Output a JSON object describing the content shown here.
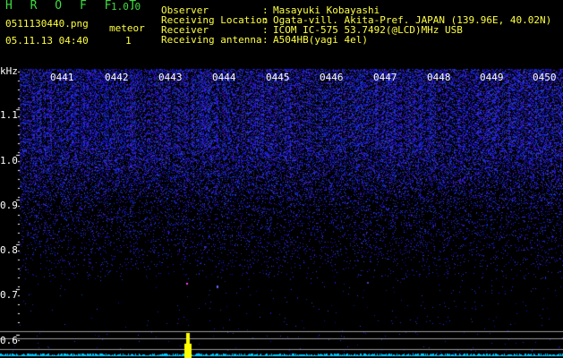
{
  "header": {
    "title": "H R O F F T",
    "version": "1.0.0",
    "filename": "0511130440.png",
    "timestamp": "05.11.13 04:40",
    "event_label": "meteor",
    "event_count": "1"
  },
  "info": [
    {
      "key": "Observer",
      "value": "Masayuki Kobayashi"
    },
    {
      "key": "Receiving Location",
      "value": "Ogata-vill. Akita-Pref. JAPAN (139.96E, 40.02N)"
    },
    {
      "key": "Receiver",
      "value": "ICOM IC-575 53.7492(@LCD)MHz USB"
    },
    {
      "key": "Receiving antenna",
      "value": "A504HB(yagi 4el)"
    }
  ],
  "spectrogram": {
    "y_unit": "kHz",
    "y_ticks": [
      "1.1",
      "1.0",
      "0.9",
      "0.8",
      "0.7",
      "0.6"
    ],
    "x_ticks": [
      "0441",
      "0442",
      "0443",
      "0444",
      "0445",
      "0446",
      "0447",
      "0448",
      "0449",
      "0450"
    ],
    "colors": {
      "background": "#000000",
      "noise": "#2a36ff",
      "signal": "#ffff00",
      "trace": "#00d0ff"
    }
  }
}
